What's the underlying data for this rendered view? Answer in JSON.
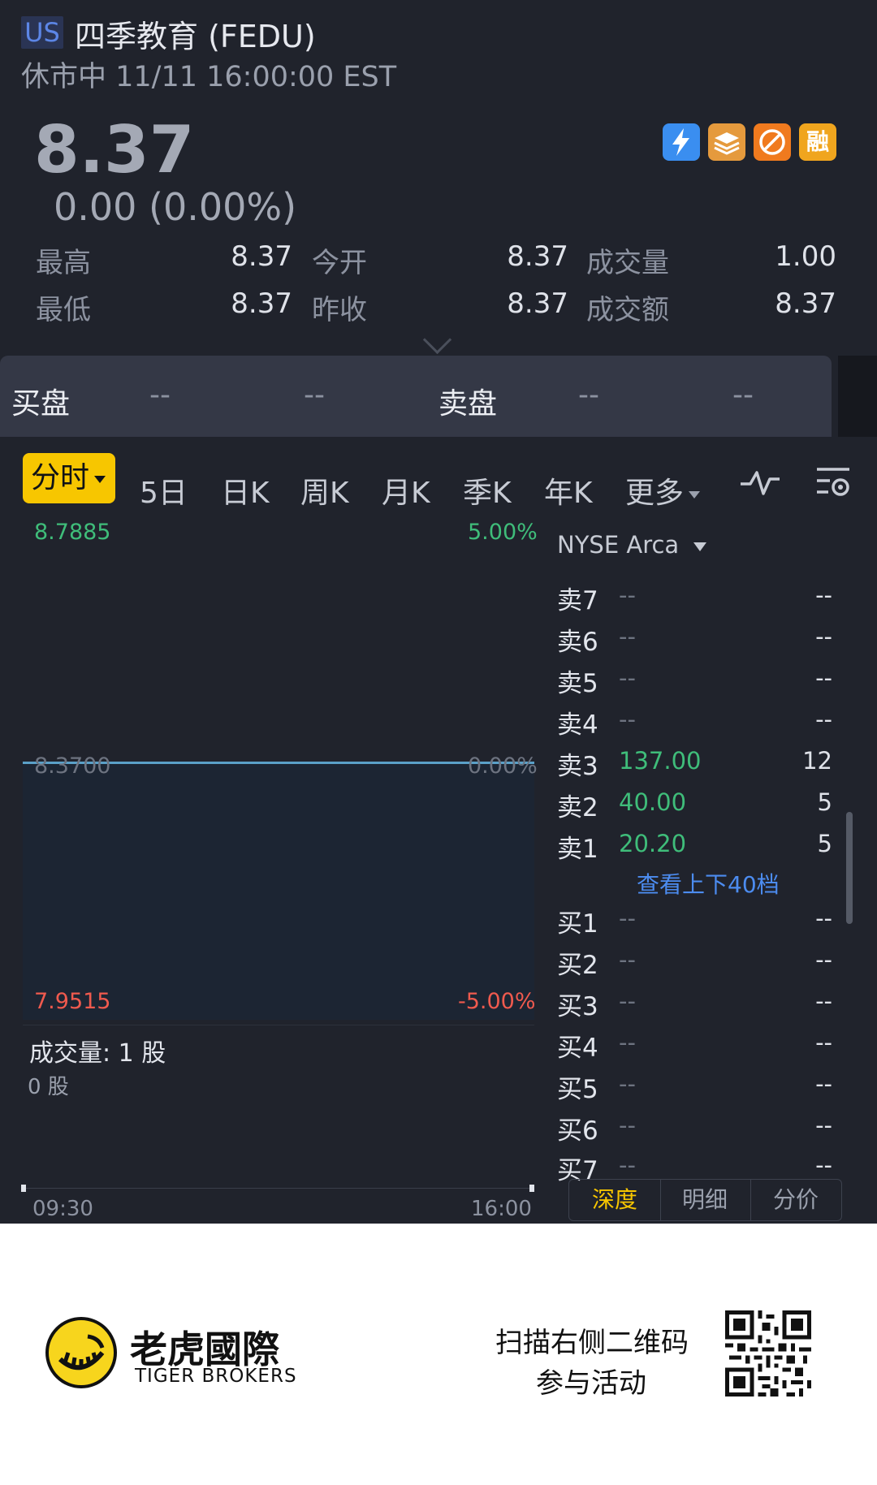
{
  "header": {
    "market_badge": "US",
    "title": "四季教育 (FEDU)",
    "status": "休市中 11/11 16:00:00 EST"
  },
  "quote": {
    "price": "8.37",
    "change": "0.00 (0.00%)",
    "tags": [
      {
        "icon": "lightning-icon",
        "color": "#3a8ef0"
      },
      {
        "icon": "book-stack-icon",
        "color": "#e59a3d"
      },
      {
        "icon": "no-short-icon",
        "color": "#f07a1e"
      },
      {
        "label": "融",
        "color": "#f0a51e"
      }
    ],
    "stats": {
      "high_label": "最高",
      "high": "8.37",
      "low_label": "最低",
      "low": "8.37",
      "open_label": "今开",
      "open": "8.37",
      "prev_close_label": "昨收",
      "prev_close": "8.37",
      "volume_label": "成交量",
      "volume": "1.00",
      "turnover_label": "成交额",
      "turnover": "8.37"
    }
  },
  "bidbar": {
    "bid_label": "买盘",
    "bid_1": "--",
    "bid_2": "--",
    "ask_label": "卖盘",
    "ask_1": "--",
    "ask_2": "--"
  },
  "tabs": {
    "active": "分时",
    "items": [
      "5日",
      "日K",
      "周K",
      "月K",
      "季K",
      "年K"
    ],
    "more": "更多"
  },
  "chart": {
    "top_price": "8.7885",
    "top_pct": "5.00%",
    "mid_price": "8.3700",
    "mid_pct": "0.00%",
    "bottom_price": "7.9515",
    "bottom_pct": "-5.00%",
    "volume_label": "成交量:",
    "volume_value": "1 股",
    "volume_axis": "0 股",
    "time_start": "09:30",
    "time_end": "16:00",
    "line_color": "#5aa0c8",
    "up_color": "#3fbd7a",
    "down_color": "#f05a4e"
  },
  "orderbook": {
    "exchange": "NYSE Arca",
    "asks": [
      {
        "label": "卖7",
        "price": "--",
        "qty": "--"
      },
      {
        "label": "卖6",
        "price": "--",
        "qty": "--"
      },
      {
        "label": "卖5",
        "price": "--",
        "qty": "--"
      },
      {
        "label": "卖4",
        "price": "--",
        "qty": "--"
      },
      {
        "label": "卖3",
        "price": "137.00",
        "qty": "12"
      },
      {
        "label": "卖2",
        "price": "40.00",
        "qty": "5"
      },
      {
        "label": "卖1",
        "price": "20.20",
        "qty": "5"
      }
    ],
    "view_more": "查看上下40档",
    "bids": [
      {
        "label": "买1",
        "price": "--",
        "qty": "--"
      },
      {
        "label": "买2",
        "price": "--",
        "qty": "--"
      },
      {
        "label": "买3",
        "price": "--",
        "qty": "--"
      },
      {
        "label": "买4",
        "price": "--",
        "qty": "--"
      },
      {
        "label": "买5",
        "price": "--",
        "qty": "--"
      },
      {
        "label": "买6",
        "price": "--",
        "qty": "--"
      },
      {
        "label": "买7",
        "price": "--",
        "qty": "--"
      }
    ],
    "segments": [
      "深度",
      "明细",
      "分价"
    ],
    "active_segment": "深度"
  },
  "footer": {
    "brand_cn": "老虎國際",
    "brand_en": "TIGER BROKERS",
    "promo_line1": "扫描右侧二维码",
    "promo_line2": "参与活动"
  }
}
